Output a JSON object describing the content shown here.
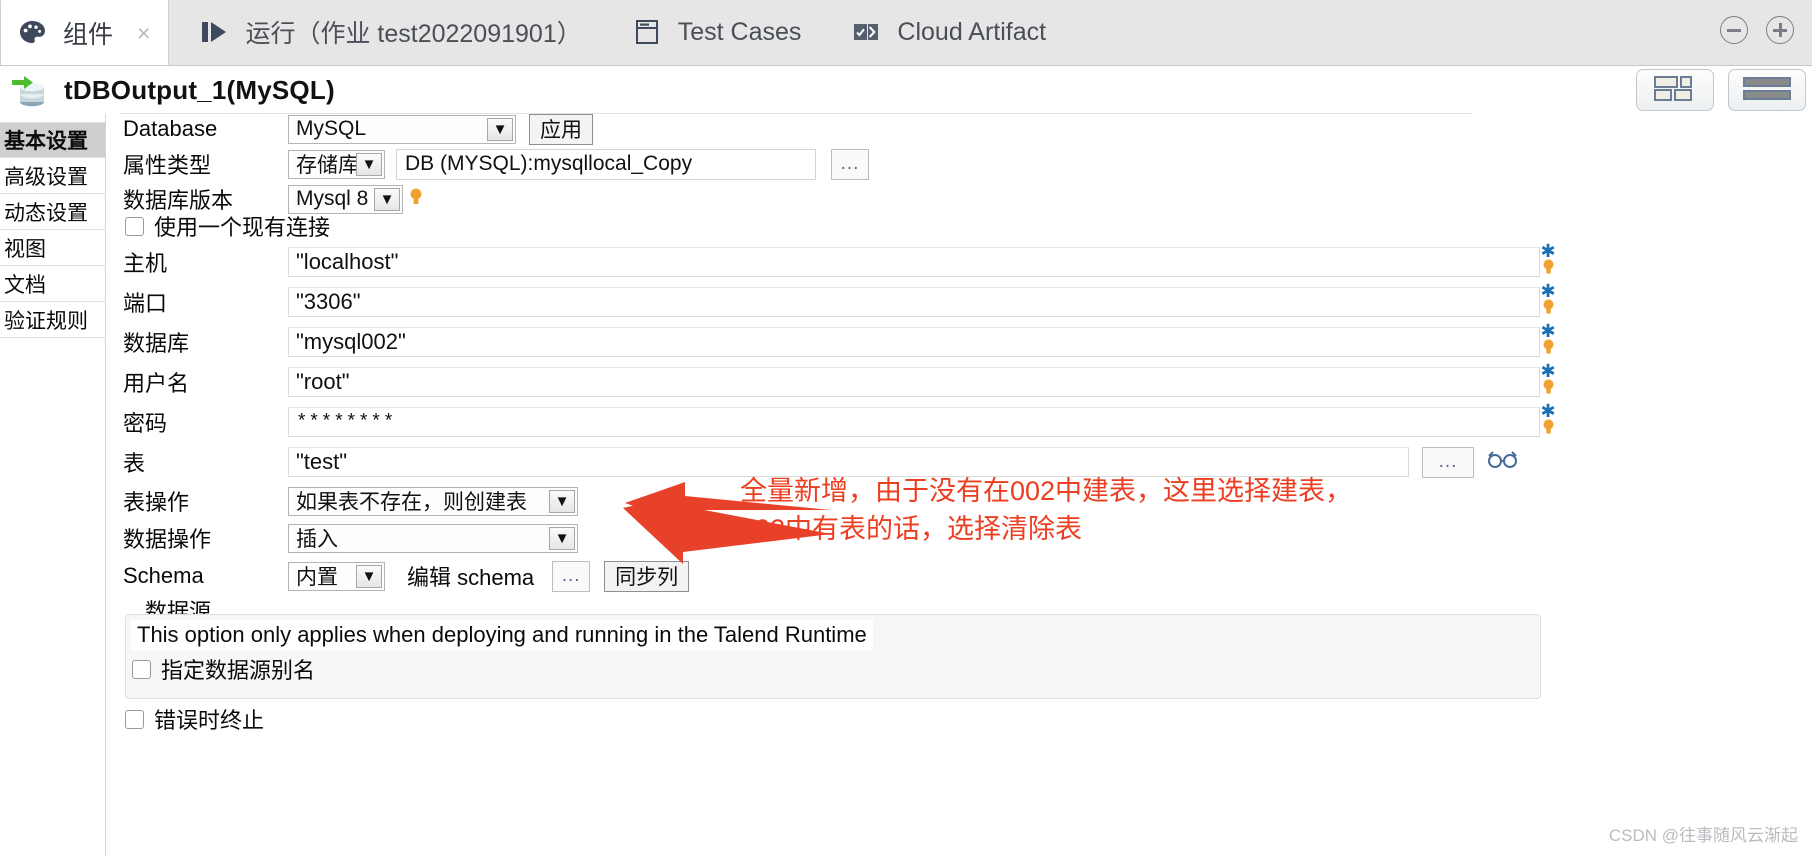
{
  "tabs": [
    {
      "label": "组件",
      "icon": "palette-icon",
      "active": true,
      "closable": true
    },
    {
      "label": "运行（作业 test2022091901）",
      "icon": "run-icon",
      "active": false,
      "closable": false
    },
    {
      "label": "Test Cases",
      "icon": "window-icon",
      "active": false,
      "closable": false
    },
    {
      "label": "Cloud Artifact",
      "icon": "cloud-artifact-icon",
      "active": false,
      "closable": false
    }
  ],
  "tab_close_glyph": "×",
  "zoom_controls": {
    "out": "−",
    "in": "+"
  },
  "header": {
    "title": "tDBOutput_1(MySQL)",
    "view_buttons": [
      "grid-view-button",
      "list-view-button"
    ]
  },
  "sidebar": {
    "items": [
      {
        "label": "基本设置",
        "selected": true
      },
      {
        "label": "高级设置",
        "selected": false
      },
      {
        "label": "动态设置",
        "selected": false
      },
      {
        "label": "视图",
        "selected": false
      },
      {
        "label": "文档",
        "selected": false
      },
      {
        "label": "验证规则",
        "selected": false
      }
    ]
  },
  "form": {
    "database": {
      "label": "Database",
      "value": "MySQL",
      "apply_label": "应用"
    },
    "property_type": {
      "label": "属性类型",
      "value": "存储库",
      "repository": "DB (MYSQL):mysqllocal_Copy",
      "browse_label": "..."
    },
    "db_version": {
      "label": "数据库版本",
      "value": "Mysql 8"
    },
    "use_existing_connection": {
      "label": "使用一个现有连接",
      "checked": false
    },
    "host": {
      "label": "主机",
      "value": "\"localhost\""
    },
    "port": {
      "label": "端口",
      "value": "\"3306\""
    },
    "dbname": {
      "label": "数据库",
      "value": "\"mysql002\""
    },
    "username": {
      "label": "用户名",
      "value": "\"root\""
    },
    "password": {
      "label": "密码",
      "value": "********"
    },
    "table": {
      "label": "表",
      "value": "\"test\"",
      "browse_label": "..."
    },
    "table_action": {
      "label": "表操作",
      "value": "如果表不存在，则创建表"
    },
    "data_action": {
      "label": "数据操作",
      "value": "插入"
    },
    "schema": {
      "label": "Schema",
      "value": "内置",
      "edit_label": "编辑 schema",
      "edit_browse_label": "...",
      "sync_label": "同步列"
    },
    "datasource": {
      "title": "数据源",
      "note": "This option only applies when deploying and running in the Talend Runtime",
      "alias": {
        "label": "指定数据源别名",
        "checked": false
      }
    },
    "die_on_error": {
      "label": "错误时终止",
      "checked": false
    }
  },
  "annotation": {
    "color": "#ec3e21",
    "line1": "全量新增，由于没有在002中建表，这里选择建表，",
    "line2": "002中有表的话，选择清除表"
  },
  "watermark": "CSDN @往事随风云渐起"
}
